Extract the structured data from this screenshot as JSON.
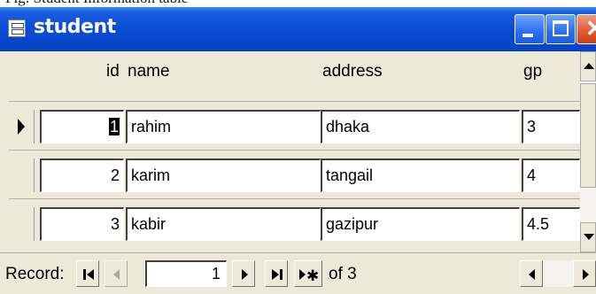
{
  "top_strip_text": "Fig: Student Information table",
  "window": {
    "title": "student"
  },
  "columns": {
    "id": "id",
    "name": "name",
    "address": "address",
    "gp": "gp"
  },
  "rows": [
    {
      "id": "1",
      "name": "rahim",
      "address": "dhaka",
      "gp": "3",
      "current": true
    },
    {
      "id": "2",
      "name": "karim",
      "address": "tangail",
      "gp": "4",
      "current": false
    },
    {
      "id": "3",
      "name": "kabir",
      "address": "gazipur",
      "gp": "4.5",
      "current": false
    }
  ],
  "navigation": {
    "label": "Record:",
    "current_record": "1",
    "total_text": "of 3"
  },
  "icons": {
    "first": "first-record-icon",
    "prev": "previous-record-icon",
    "next": "next-record-icon",
    "last": "last-record-icon",
    "new": "new-record-icon"
  },
  "colors": {
    "titlebar": "#0a4bd6",
    "close": "#e05a2e",
    "background": "#ece9d8"
  }
}
